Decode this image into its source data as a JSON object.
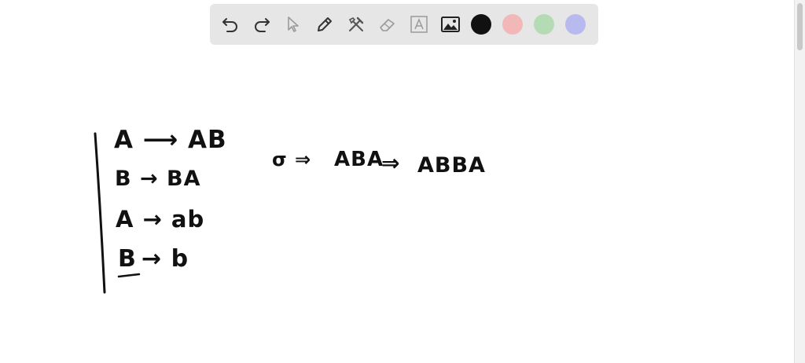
{
  "toolbar": {
    "tools": [
      {
        "name": "undo-icon",
        "enabled": true
      },
      {
        "name": "redo-icon",
        "enabled": true
      },
      {
        "name": "select-pointer-icon",
        "enabled": false
      },
      {
        "name": "pencil-icon",
        "enabled": true
      },
      {
        "name": "tools-icon",
        "enabled": true
      },
      {
        "name": "eraser-icon",
        "enabled": false
      },
      {
        "name": "text-box-icon",
        "enabled": false
      },
      {
        "name": "image-icon",
        "enabled": true
      }
    ],
    "colors": [
      "#111111",
      "#f2b8b8",
      "#b5dbb5",
      "#b7b9ef"
    ]
  },
  "board": {
    "rule_1": "A ⟶ AB",
    "rule_2": "B → BA",
    "rule_3": "A → ab",
    "rule_4_left": "B",
    "rule_4_right": "→ b",
    "derivation_start": "σ ⇒",
    "derivation_step1": "ABA",
    "derivation_arrow": "⇒",
    "derivation_step2": "ABBA"
  }
}
